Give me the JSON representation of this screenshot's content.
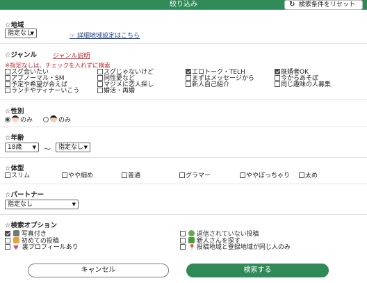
{
  "header": {
    "title": "絞り込み",
    "reset_label": "検索条件をリセット"
  },
  "region": {
    "title": "☆地域",
    "select_value": "指定なし",
    "detail_link": "詳細地域設定はこちら"
  },
  "genre": {
    "title": "☆ジャンル",
    "help_link": "ジャンル説明",
    "note": "※指定なしは、チェックを入れずに検索",
    "items": [
      {
        "label": "スグ会いたい",
        "checked": false
      },
      {
        "label": "アブノーマル・SM",
        "checked": false
      },
      {
        "label": "予定や希望が合えば",
        "checked": false
      },
      {
        "label": "ランチやディナーいこう",
        "checked": false
      },
      {
        "label": "スグじゃないけど",
        "checked": false
      },
      {
        "label": "同性愛など",
        "checked": false
      },
      {
        "label": "マジメに恋人探し",
        "checked": false
      },
      {
        "label": "婚活・再婚",
        "checked": false
      },
      {
        "label": "エロトーク・TELH",
        "checked": true
      },
      {
        "label": "まずはメッセージから",
        "checked": false
      },
      {
        "label": "新人自己紹介",
        "checked": false
      },
      {
        "label": "既婚者OK",
        "checked": true
      },
      {
        "label": "今からあそぼ",
        "checked": false
      },
      {
        "label": "同じ趣味の人募集",
        "checked": false
      }
    ]
  },
  "gender": {
    "title": "☆性別",
    "options": [
      {
        "label": "のみ",
        "selected": true
      },
      {
        "label": "のみ",
        "selected": false
      }
    ]
  },
  "age": {
    "title": "☆年齢",
    "from_value": "18歳",
    "separator": "〜",
    "to_value": "指定なし"
  },
  "body": {
    "title": "☆体型",
    "items": [
      "スリム",
      "やや細め",
      "普通",
      "グラマー",
      "ややぽっちゃり",
      "太め"
    ]
  },
  "partner": {
    "title": "☆パートナー",
    "select_value": "指定なし"
  },
  "options": {
    "title": "☆検索オプション",
    "left": [
      {
        "label": "写真付き",
        "checked": true,
        "icon": "photo-icon"
      },
      {
        "label": "初めての投稿",
        "checked": false,
        "icon": "first-post-icon"
      },
      {
        "label": "裏プロフィールあり",
        "checked": false,
        "icon": "heart-icon"
      }
    ],
    "right": [
      {
        "label": "返信されていない投稿",
        "checked": false,
        "icon": "clover-icon"
      },
      {
        "label": "新人さんを探す",
        "checked": false,
        "icon": "beginner-icon"
      },
      {
        "label": "投稿地域と登録地域が同じ人のみ",
        "checked": false,
        "icon": "pin-icon"
      }
    ]
  },
  "footer": {
    "cancel_label": "キャンセル",
    "search_label": "検索する"
  },
  "colors": {
    "accent": "#2f8a58",
    "warning": "#c0282e",
    "link": "#1a3e8c"
  }
}
